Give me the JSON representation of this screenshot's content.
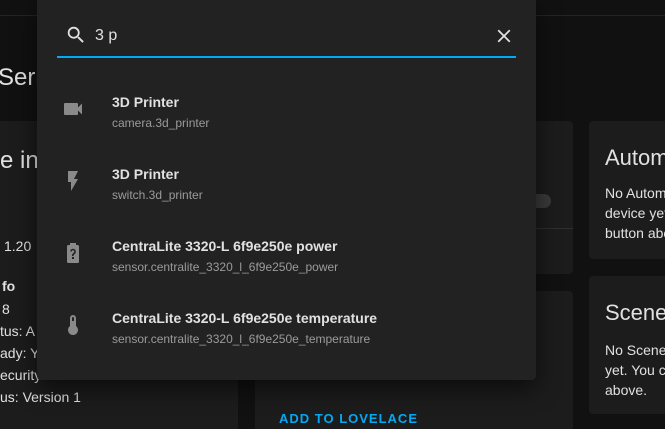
{
  "background": {
    "page_title_partial": "Seri",
    "card_left_title_partial": "e inf",
    "card_left_lines": [
      "1.20",
      "fo",
      "8",
      "tus: A",
      "ady: Y",
      "ecurity",
      "us: Version 1"
    ],
    "automations_title_partial": "Autom",
    "automations_text_lines": [
      "No Autom",
      "device yet",
      "button abo"
    ],
    "scenes_title_partial": "Scene",
    "scenes_text_lines": [
      "No Scene",
      "yet. You c",
      "above."
    ],
    "add_to_lovelace": "ADD TO LOVELACE"
  },
  "search": {
    "value": "3 p",
    "icon": "search-icon",
    "close_icon": "close-icon",
    "underline_color": "#03a9f4"
  },
  "results": [
    {
      "icon": "camera-icon",
      "name": "3D Printer",
      "entity_id": "camera.3d_printer"
    },
    {
      "icon": "flash-icon",
      "name": "3D Printer",
      "entity_id": "switch.3d_printer"
    },
    {
      "icon": "battery-unknown-icon",
      "name": "CentraLite 3320-L 6f9e250e power",
      "entity_id": "sensor.centralite_3320_l_6f9e250e_power"
    },
    {
      "icon": "thermometer-icon",
      "name": "CentraLite 3320-L 6f9e250e temperature",
      "entity_id": "sensor.centralite_3320_l_6f9e250e_temperature"
    }
  ],
  "colors": {
    "accent": "#03a9f4",
    "dialog_bg": "#222222",
    "page_bg": "#111111",
    "primary_text": "#e1e1e1",
    "secondary_text": "#9b9b9b"
  }
}
